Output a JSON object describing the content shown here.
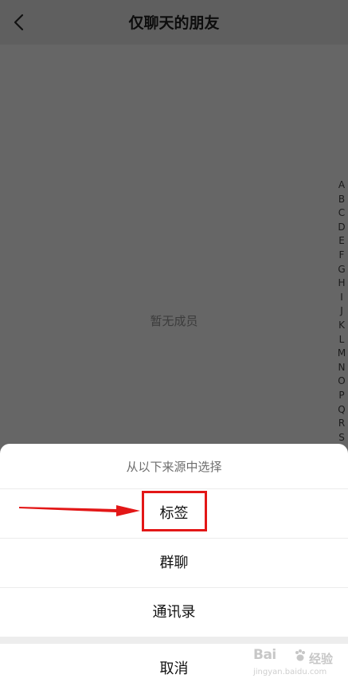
{
  "header": {
    "title": "仅聊天的朋友",
    "back_icon": "chevron-left-icon"
  },
  "main": {
    "empty_text": "暂无成员"
  },
  "index_bar": {
    "letters": [
      "A",
      "B",
      "C",
      "D",
      "E",
      "F",
      "G",
      "H",
      "I",
      "J",
      "K",
      "L",
      "M",
      "N",
      "O",
      "P",
      "Q",
      "R",
      "S"
    ]
  },
  "action_sheet": {
    "title": "从以下来源中选择",
    "options": [
      {
        "label": "标签"
      },
      {
        "label": "群聊"
      },
      {
        "label": "通讯录"
      }
    ],
    "cancel_label": "取消"
  },
  "annotation": {
    "highlight_color": "#e31717",
    "highlighted_option": "标签"
  },
  "watermark": {
    "logo_text": "Bai",
    "suffix_text": "经验",
    "url": "jingyan.baidu.com"
  },
  "colors": {
    "overlay_bg": "#666666",
    "sheet_bg": "#ffffff",
    "annotation_red": "#e31717"
  }
}
